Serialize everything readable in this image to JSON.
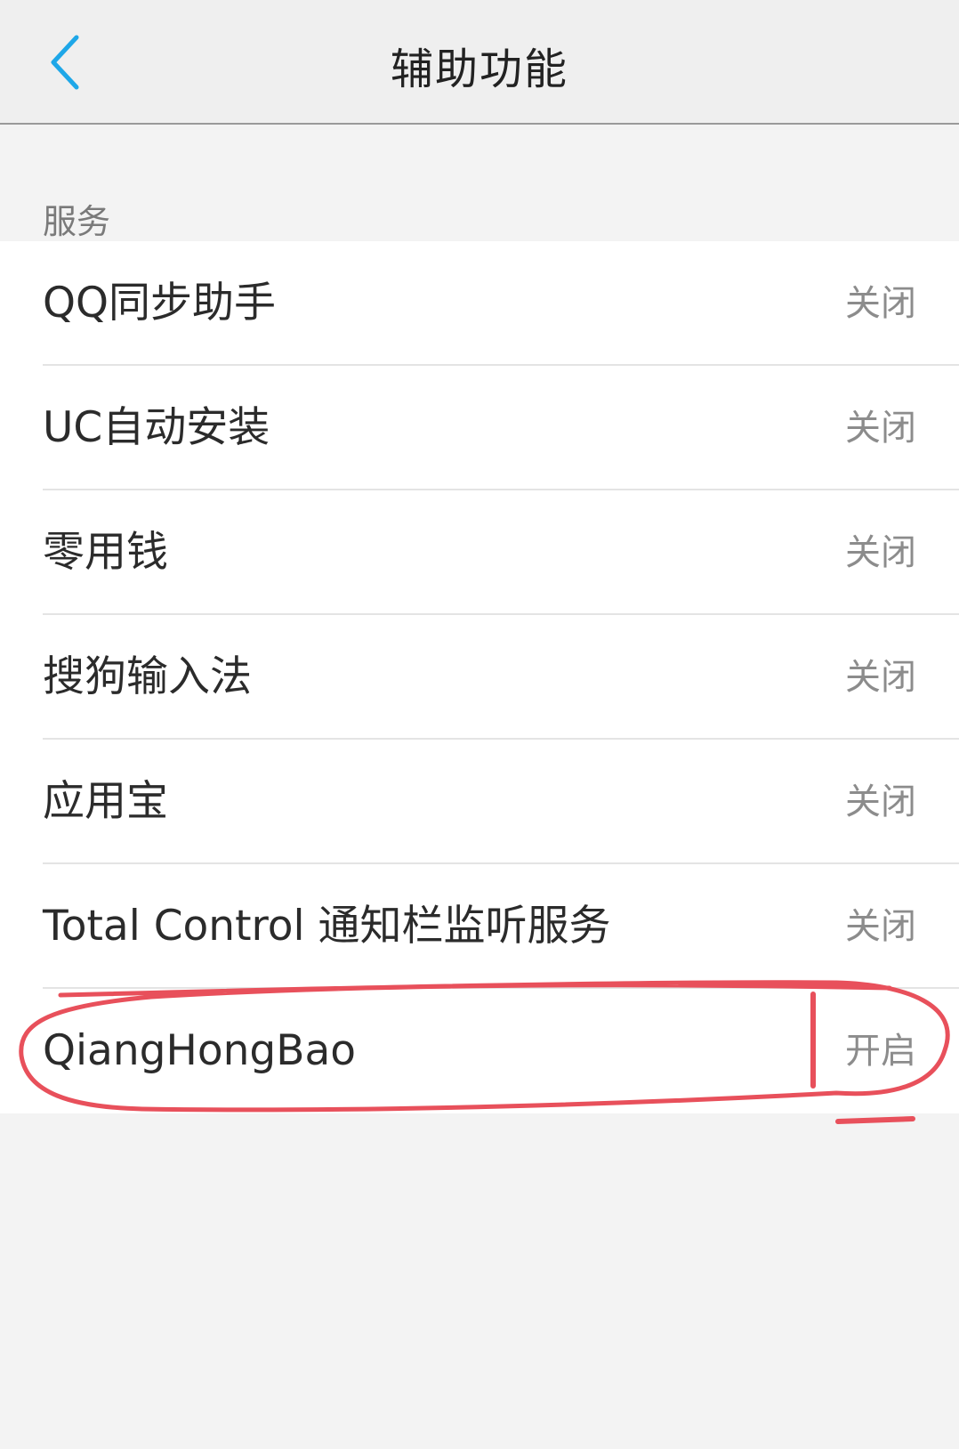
{
  "header": {
    "title": "辅助功能",
    "back_icon": "chevron-left-icon",
    "accent_color": "#1ea7e8"
  },
  "section": {
    "label": "服务"
  },
  "services": [
    {
      "label": "QQ同步助手",
      "status": "关闭"
    },
    {
      "label": "UC自动安装",
      "status": "关闭"
    },
    {
      "label": "零用钱",
      "status": "关闭"
    },
    {
      "label": "搜狗输入法",
      "status": "关闭"
    },
    {
      "label": "应用宝",
      "status": "关闭"
    },
    {
      "label": "Total Control 通知栏监听服务",
      "status": "关闭"
    },
    {
      "label": "QiangHongBao",
      "status": "开启"
    }
  ],
  "annotation": {
    "color": "#e8505b"
  }
}
